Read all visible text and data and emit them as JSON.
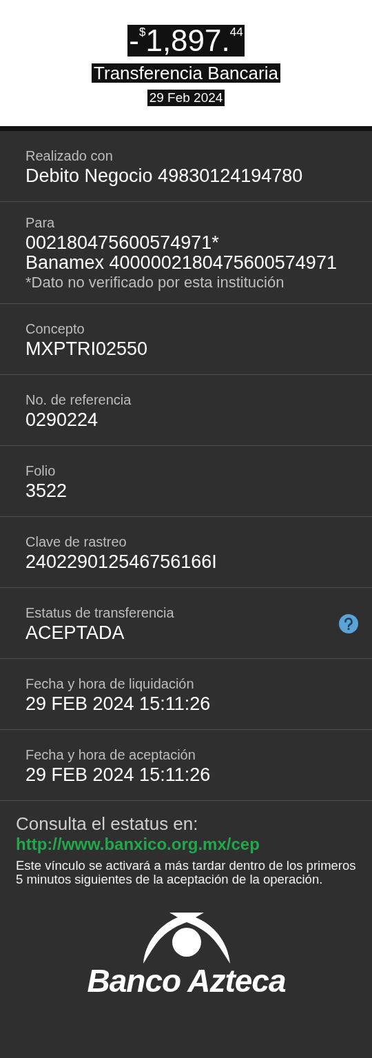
{
  "header": {
    "amount": {
      "sign": "-",
      "currency": "$",
      "whole": "1,897.",
      "cents": "44"
    },
    "title": "Transferencia Bancaria",
    "date": "29 Feb 2024"
  },
  "details": [
    {
      "label": "Realizado con",
      "lines": [
        "Debito Negocio 49830124194780"
      ],
      "help": false
    },
    {
      "label": "Para",
      "lines": [
        "002180475600574971*",
        "Banamex 4000002180475600574971"
      ],
      "note": "*Dato no verificado por esta institución",
      "help": false
    },
    {
      "label": "Concepto",
      "lines": [
        "MXPTRI02550"
      ],
      "help": false
    },
    {
      "label": "No. de referencia",
      "lines": [
        "0290224"
      ],
      "help": false
    },
    {
      "label": "Folio",
      "lines": [
        "3522"
      ],
      "help": false
    },
    {
      "label": "Clave de rastreo",
      "lines": [
        "240229012546756166I"
      ],
      "help": false
    },
    {
      "label": "Estatus de transferencia",
      "lines": [
        "ACEPTADA"
      ],
      "help": true
    },
    {
      "label": "Fecha y hora de liquidación",
      "lines": [
        "29 FEB 2024 15:11:26"
      ],
      "help": false
    },
    {
      "label": "Fecha y hora de aceptación",
      "lines": [
        "29 FEB 2024 15:11:26"
      ],
      "help": false
    }
  ],
  "footer": {
    "heading": "Consulta el estatus en:",
    "link": "http://www.banxico.org.mx/cep",
    "notice": "Este vínculo se activará a más tardar dentro de los primeros 5 minutos siguientes de la aceptación de la operación.",
    "brand": "Banco Azteca"
  }
}
